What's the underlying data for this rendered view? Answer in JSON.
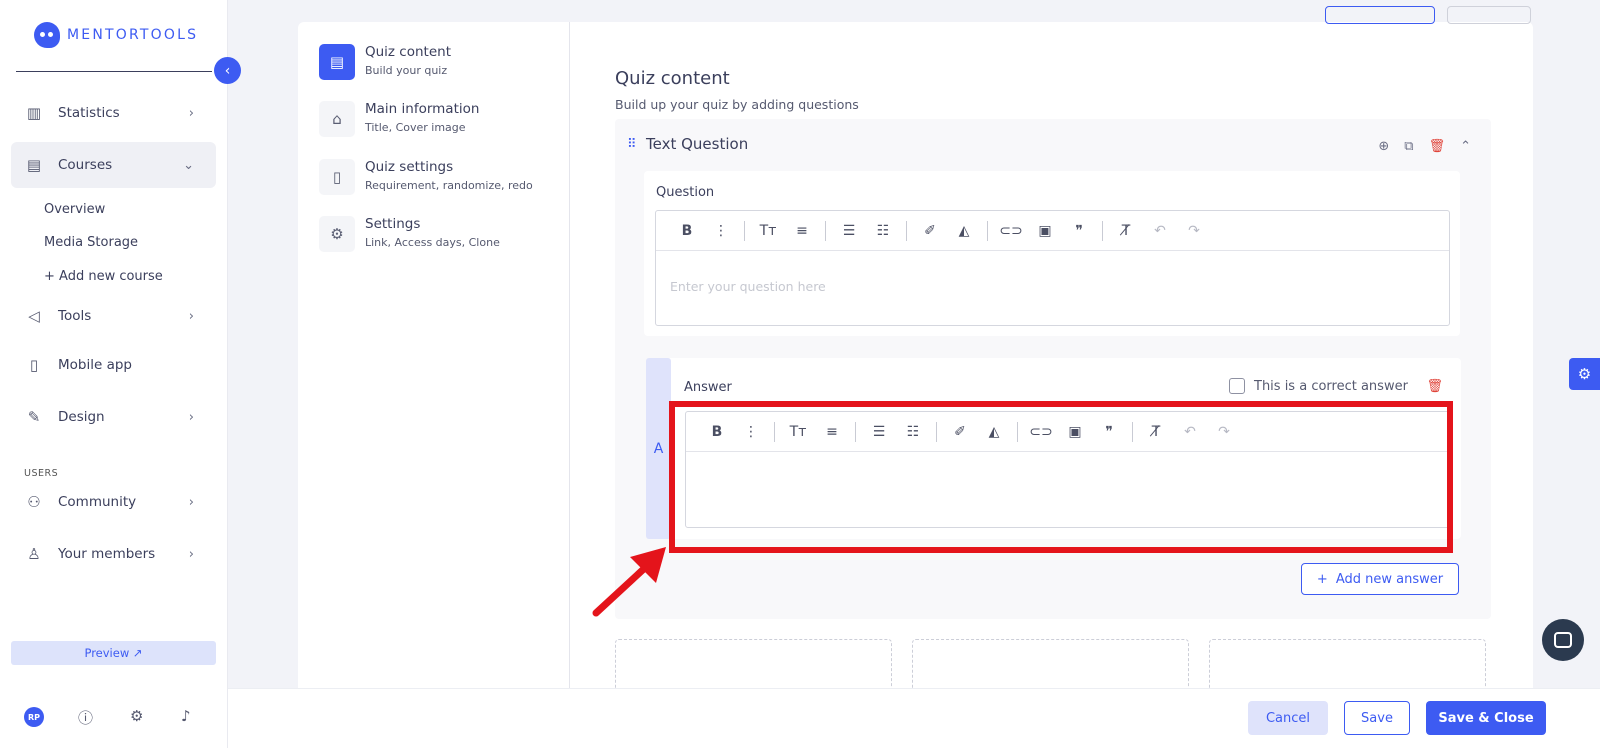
{
  "brand": {
    "name": "MENTORTOOLS"
  },
  "sidebar": {
    "items": [
      {
        "label": "Statistics",
        "icon": "bar-chart-icon"
      },
      {
        "label": "Courses",
        "icon": "book-icon"
      },
      {
        "label": "Tools",
        "icon": "megaphone-icon"
      },
      {
        "label": "Mobile app",
        "icon": "phone-icon"
      },
      {
        "label": "Design",
        "icon": "edit-icon"
      },
      {
        "label": "Community",
        "icon": "people-icon"
      },
      {
        "label": "Your members",
        "icon": "user-icon"
      }
    ],
    "sub_items": [
      "Overview",
      "Media Storage",
      "+ Add new course"
    ],
    "section_users": "USERS",
    "preview_label": "Preview ↗",
    "avatar_initials": "RP"
  },
  "steps": [
    {
      "title": "Quiz content",
      "sub": "Build your quiz",
      "active": true
    },
    {
      "title": "Main information",
      "sub": "Title, Cover image"
    },
    {
      "title": "Quiz settings",
      "sub": "Requirement, randomize, redo"
    },
    {
      "title": "Settings",
      "sub": "Link, Access days, Clone"
    }
  ],
  "content": {
    "title": "Quiz content",
    "subtitle": "Build up your quiz by adding questions"
  },
  "question": {
    "title": "Text Question",
    "label": "Question",
    "placeholder": "Enter your question here"
  },
  "answer": {
    "letter": "A",
    "label": "Answer",
    "correct_label": "This is a correct answer",
    "add_label": "Add new answer"
  },
  "footer": {
    "cancel": "Cancel",
    "save": "Save",
    "save_close": "Save & Close"
  },
  "colors": {
    "accent": "#3d5bf2",
    "highlight": "#e4141b",
    "danger": "#e0443a"
  }
}
